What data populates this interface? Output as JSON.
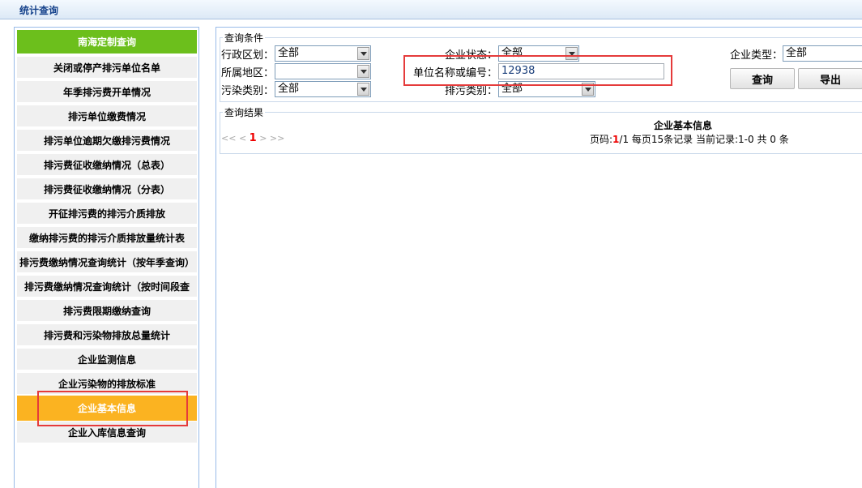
{
  "title": "统计查询",
  "sidebar": {
    "items": [
      {
        "label": "南海定制查询"
      },
      {
        "label": "关闭或停产排污单位名单"
      },
      {
        "label": "年季排污费开单情况"
      },
      {
        "label": "排污单位缴费情况"
      },
      {
        "label": "排污单位逾期欠缴排污费情况"
      },
      {
        "label": "排污费征收缴纳情况（总表）"
      },
      {
        "label": "排污费征收缴纳情况（分表）"
      },
      {
        "label": "开征排污费的排污介质排放"
      },
      {
        "label": "缴纳排污费的排污介质排放量统计表"
      },
      {
        "label": "排污费缴纳情况查询统计（按年季查询）"
      },
      {
        "label": "排污费缴纳情况查询统计（按时间段查"
      },
      {
        "label": "排污费限期缴纳查询"
      },
      {
        "label": "排污费和污染物排放总量统计"
      },
      {
        "label": "企业监测信息"
      },
      {
        "label": "企业污染物的排放标准"
      },
      {
        "label": "企业基本信息"
      },
      {
        "label": "企业入库信息查询"
      }
    ]
  },
  "query": {
    "legend": "查询条件",
    "xzqh_label": "行政区划：",
    "xzqh_value": "全部",
    "ssdq_label": "所属地区：",
    "ssdq_value": "",
    "wrlb_label": "污染类别：",
    "wrlb_value": "全部",
    "qyzt_label": "企业状态：",
    "qyzt_value": "全部",
    "dwmc_label": "单位名称或编号：",
    "dwmc_value": "12938",
    "pwlb_label": "排污类别：",
    "pwlb_value": "全部",
    "qylx_label": "企业类型：",
    "qylx_value": "全部",
    "search_label": "查询",
    "export_label": "导出"
  },
  "result": {
    "legend": "查询结果",
    "table_title": "企业基本信息",
    "pager_first": "<<",
    "pager_prev": "<",
    "pager_current": "1",
    "pager_next": ">",
    "pager_last": ">>",
    "page_prefix": "页码:",
    "page_current": "1",
    "page_suffix": "/1 每页15条记录  当前记录:1-0 共 0 条"
  }
}
